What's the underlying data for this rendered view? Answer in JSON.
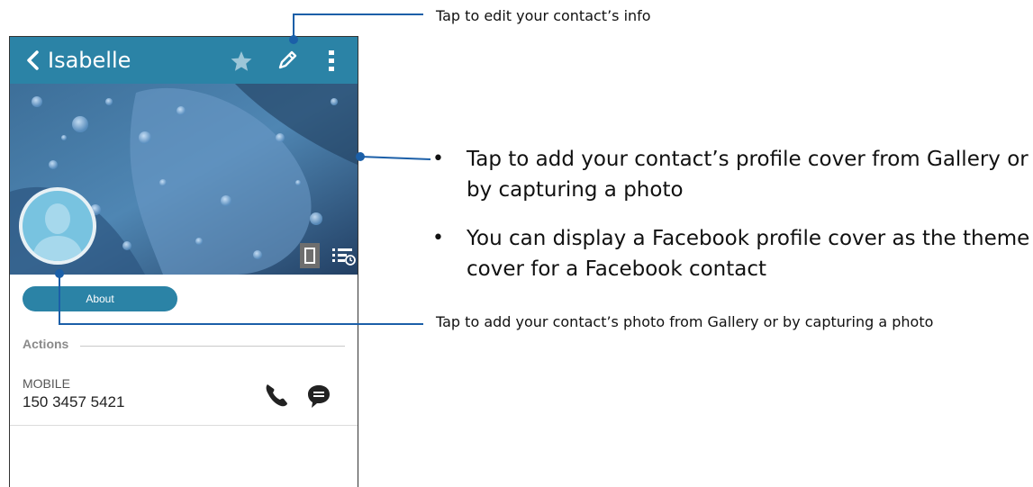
{
  "header": {
    "title": "Isabelle"
  },
  "profile": {
    "about_label": "About"
  },
  "actions": {
    "section_label": "Actions",
    "phone_type": "MOBILE",
    "phone_number": "150 3457 5421"
  },
  "callouts": {
    "edit_info": "Tap to edit your contact’s info",
    "cover_bullets": [
      "Tap to add your contact’s profile cover from Gallery or by capturing a photo",
      "You can display a Facebook profile cover as the theme cover for a Facebook contact"
    ],
    "add_photo": "Tap to add your contact’s photo from Gallery or by capturing a photo"
  },
  "colors": {
    "appbar": "#2b83a6",
    "callout_line": "#1b5fa8"
  },
  "icons": [
    "back-icon",
    "star-icon",
    "pencil-icon",
    "overflow-menu-icon",
    "phone-icon",
    "message-icon",
    "cover-mode-icon",
    "list-clock-icon",
    "avatar-silhouette-icon"
  ]
}
